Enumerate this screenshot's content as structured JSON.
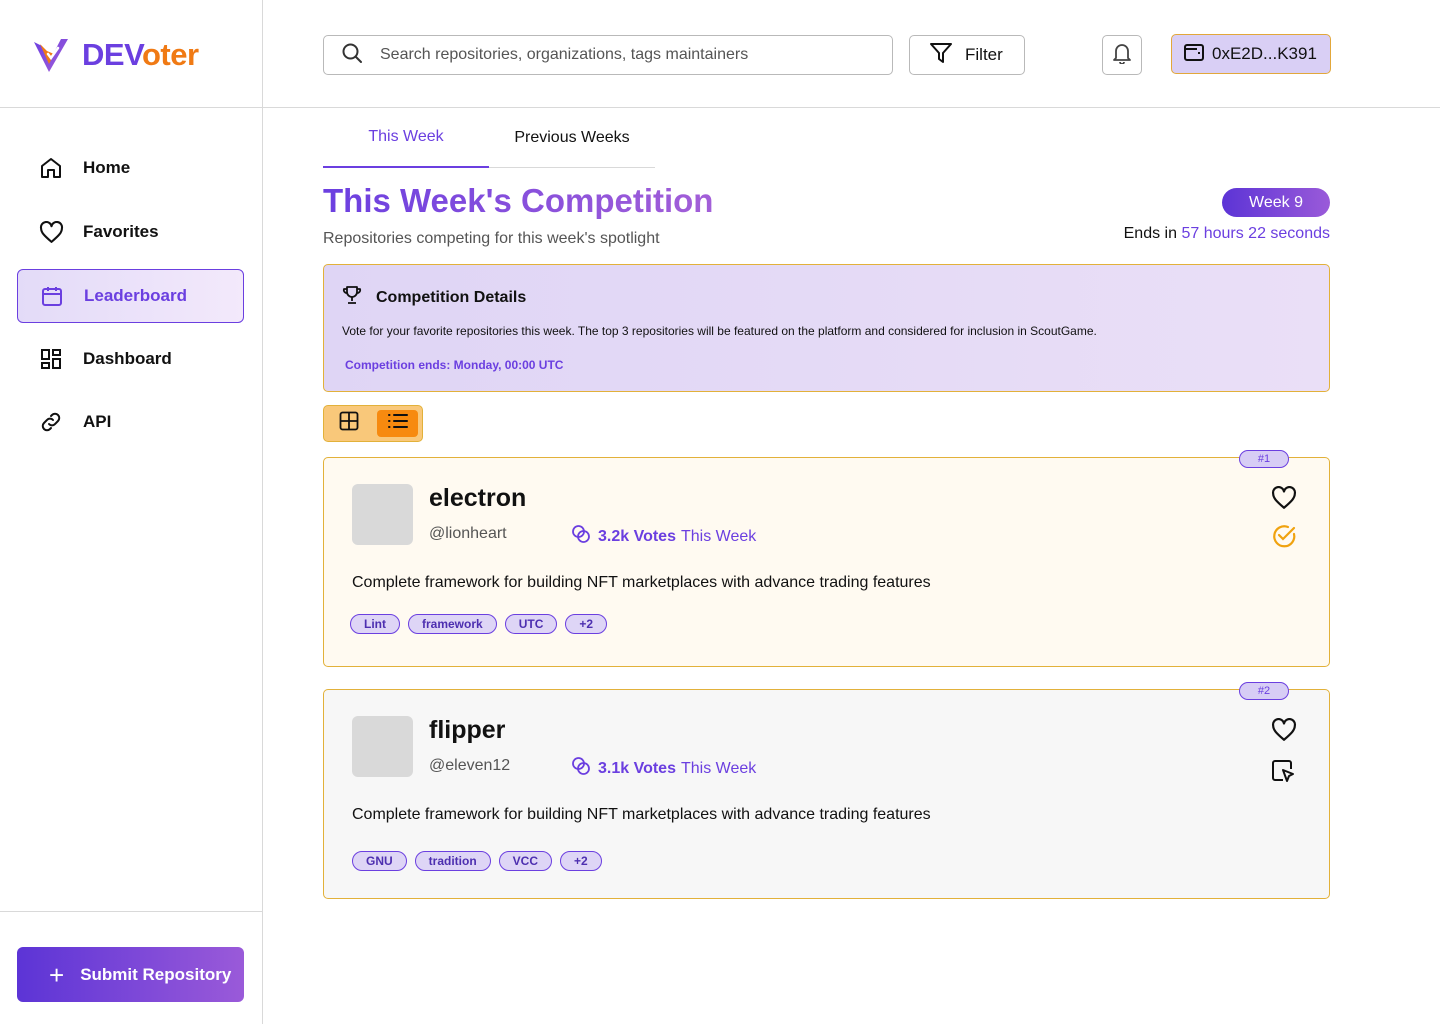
{
  "brand": {
    "name_part1": "DEV",
    "name_part2": "oter",
    "primary_color": "#6b3fe0",
    "accent_color": "#f07a14"
  },
  "sidebar": {
    "items": [
      {
        "label": "Home",
        "icon": "home-icon",
        "active": false
      },
      {
        "label": "Favorites",
        "icon": "heart-icon",
        "active": false
      },
      {
        "label": "Leaderboard",
        "icon": "calendar-icon",
        "active": true
      },
      {
        "label": "Dashboard",
        "icon": "dashboard-icon",
        "active": false
      },
      {
        "label": "API",
        "icon": "link-icon",
        "active": false
      }
    ],
    "submit_label": "Submit Repository"
  },
  "header": {
    "search_placeholder": "Search repositories, organizations, tags maintainers",
    "filter_label": "Filter",
    "wallet_label": "0xE2D...K391"
  },
  "tabs": [
    {
      "label": "This Week",
      "active": true
    },
    {
      "label": "Previous Weeks",
      "active": false
    }
  ],
  "main": {
    "title": "This Week's Competition",
    "subtitle": "Repositories competing for this week's spotlight",
    "week_badge": "Week 9",
    "ends_prefix": "Ends in",
    "ends_value": "57 hours 22 seconds"
  },
  "details": {
    "title": "Competition Details",
    "body": "Vote for your favorite repositories this week. The top 3 repositories will be featured on the platform and considered for inclusion in ScoutGame.",
    "ends": "Competition ends: Monday, 00:00 UTC"
  },
  "view_toggle": {
    "selected": "list"
  },
  "repositories": [
    {
      "rank": "#1",
      "name": "electron",
      "owner": "@lionheart",
      "votes": "3.2k Votes",
      "votes_suffix": "This Week",
      "description": "Complete framework for building NFT marketplaces with advance trading features",
      "tags": [
        "Lint",
        "framework",
        "UTC",
        "+2"
      ],
      "voted": true
    },
    {
      "rank": "#2",
      "name": "flipper",
      "owner": "@eleven12",
      "votes": "3.1k Votes",
      "votes_suffix": "This Week",
      "description": "Complete framework for building NFT marketplaces with advance trading features",
      "tags": [
        "GNU",
        "tradition",
        "VCC",
        "+2"
      ],
      "voted": false
    }
  ]
}
